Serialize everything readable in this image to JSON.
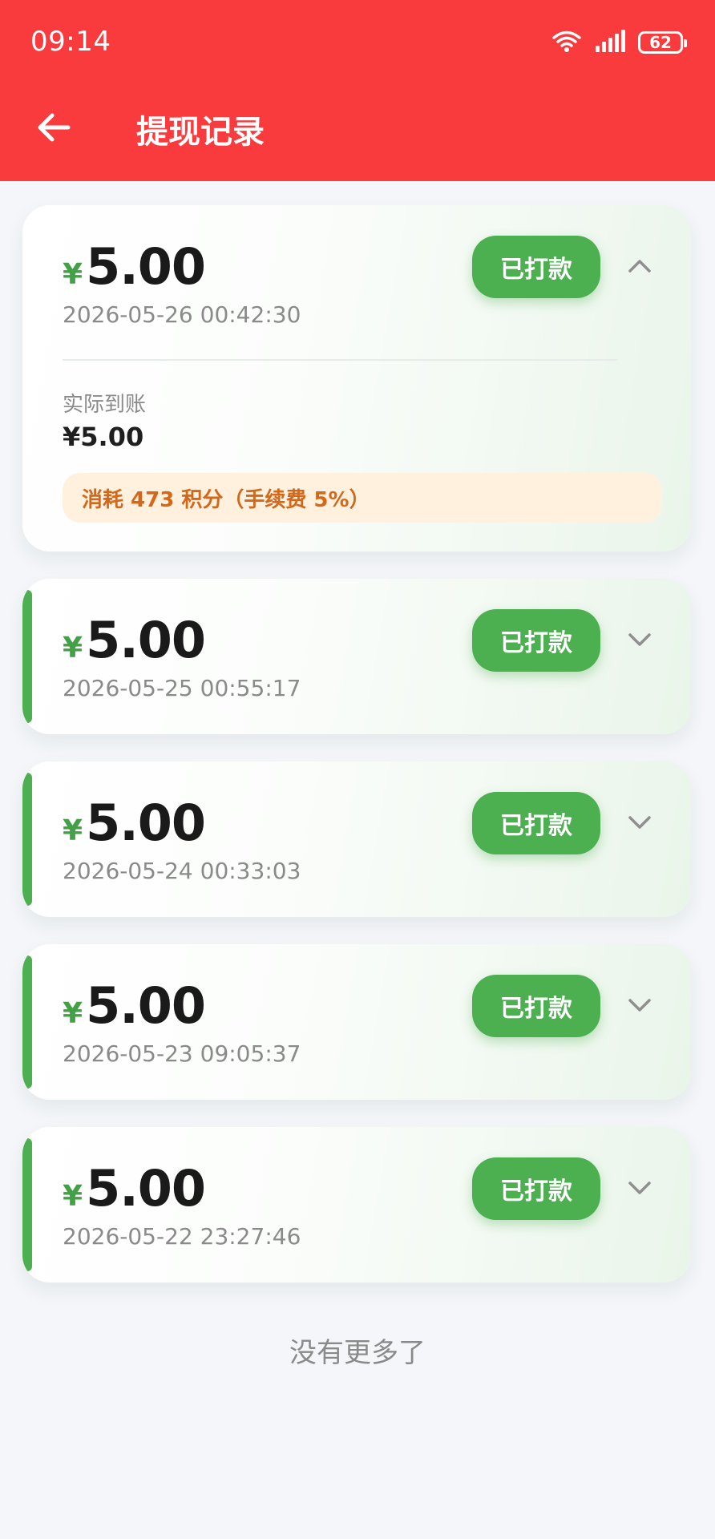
{
  "status_bar": {
    "time": "09:14",
    "battery": "62",
    "icons": [
      "wifi-icon",
      "signal-icon",
      "battery-icon"
    ]
  },
  "header": {
    "title": "提现记录",
    "back_icon": "arrow-left-icon"
  },
  "records": [
    {
      "currency": "¥",
      "amount": "5.00",
      "datetime": "2026-05-26 00:42:30",
      "status": "已打款",
      "expanded": true,
      "detail_label": "实际到账",
      "detail_value": "¥5.00",
      "fee_note": "消耗 473 积分（手续费 5%）"
    },
    {
      "currency": "¥",
      "amount": "5.00",
      "datetime": "2026-05-25 00:55:17",
      "status": "已打款",
      "expanded": false
    },
    {
      "currency": "¥",
      "amount": "5.00",
      "datetime": "2026-05-24 00:33:03",
      "status": "已打款",
      "expanded": false
    },
    {
      "currency": "¥",
      "amount": "5.00",
      "datetime": "2026-05-23 09:05:37",
      "status": "已打款",
      "expanded": false
    },
    {
      "currency": "¥",
      "amount": "5.00",
      "datetime": "2026-05-22 23:27:46",
      "status": "已打款",
      "expanded": false
    }
  ],
  "footer": {
    "end_text": "没有更多了"
  },
  "colors": {
    "header_bg": "#fa3b3e",
    "status_green": "#4caf50",
    "fee_bg": "#fff1de",
    "fee_text": "#d4681a",
    "page_bg": "#f4f6f9"
  }
}
